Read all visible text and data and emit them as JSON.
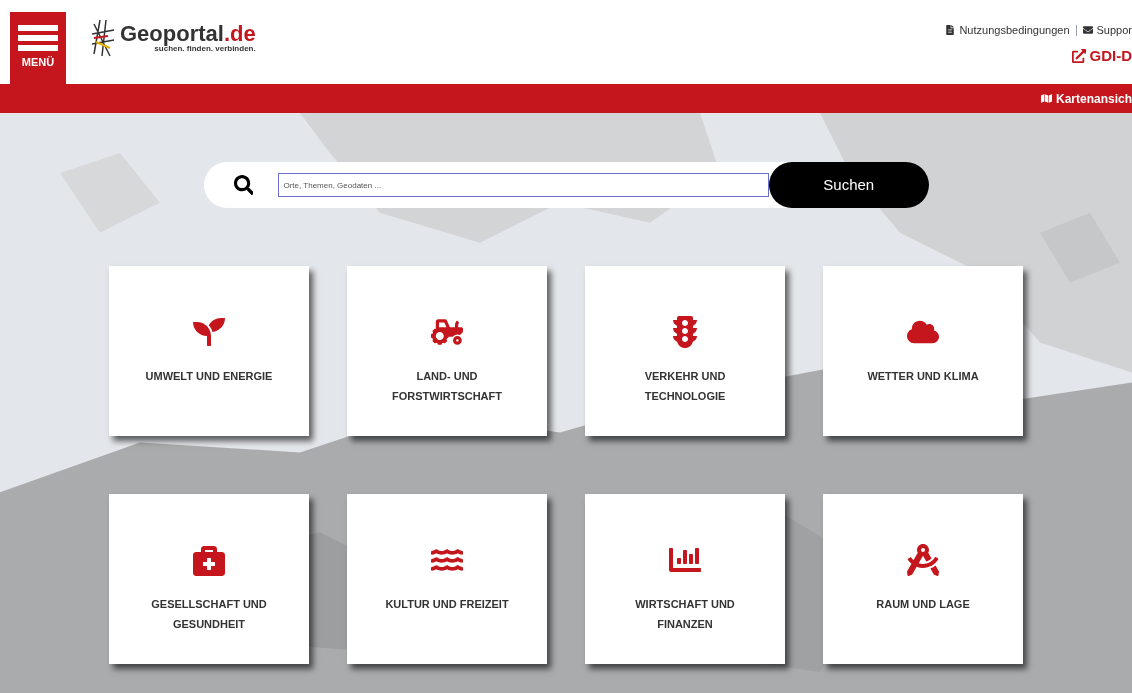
{
  "header": {
    "menu_label": "MENÜ",
    "logo_text": "Geoportal",
    "logo_suffix": ".de",
    "tagline": "suchen. finden. verbinden.",
    "links": [
      "Nutzungsbedingungen",
      "Suppor"
    ],
    "gdi_link": "GDI-D"
  },
  "red_bar": {
    "map_link": "Kartenansich"
  },
  "search": {
    "placeholder": "Orte, Themen, Geodaten ...",
    "button": "Suchen"
  },
  "tiles": [
    {
      "label": "UMWELT UND ENERGIE"
    },
    {
      "label": "LAND- UND\nFORSTWIRTSCHAFT"
    },
    {
      "label": "VERKEHR UND\nTECHNOLOGIE"
    },
    {
      "label": "WETTER UND KLIMA"
    },
    {
      "label": "GESELLSCHAFT UND\nGESUNDHEIT"
    },
    {
      "label": "KULTUR UND FREIZEIT"
    },
    {
      "label": "WIRTSCHAFT UND\nFINANZEN"
    },
    {
      "label": "RAUM UND LAGE"
    }
  ]
}
